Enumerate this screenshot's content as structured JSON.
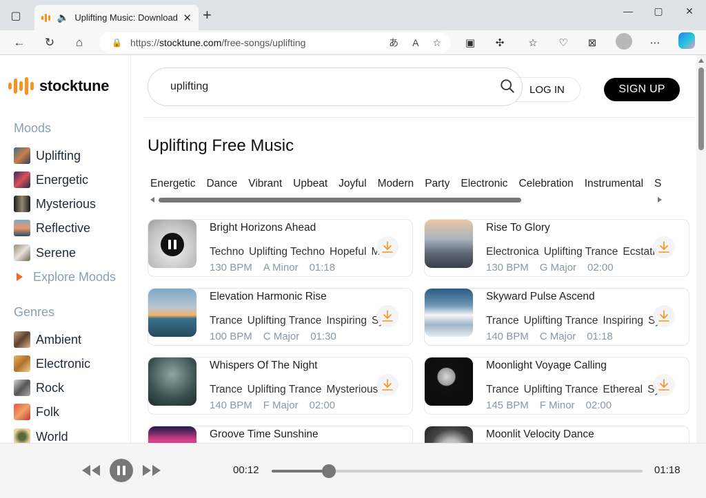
{
  "browser": {
    "tab_title": "Uplifting Music: Download Free",
    "url_prefix": "https://",
    "url_host": "stocktune.com",
    "url_path": "/free-songs/uplifting"
  },
  "site": {
    "logo_text": "stocktune",
    "accent": "#f7931e"
  },
  "sidebar": {
    "moods_heading": "Moods",
    "moods": [
      {
        "label": "Uplifting"
      },
      {
        "label": "Energetic"
      },
      {
        "label": "Mysterious"
      },
      {
        "label": "Reflective"
      },
      {
        "label": "Serene"
      }
    ],
    "explore_label": "Explore Moods",
    "genres_heading": "Genres",
    "genres": [
      {
        "label": "Ambient"
      },
      {
        "label": "Electronic"
      },
      {
        "label": "Rock"
      },
      {
        "label": "Folk"
      },
      {
        "label": "World"
      }
    ]
  },
  "header": {
    "search_value": "uplifting",
    "login_label": "LOG IN",
    "signup_label": "SIGN UP"
  },
  "main": {
    "title": "Uplifting Free Music",
    "chips": [
      "Energetic",
      "Dance",
      "Vibrant",
      "Upbeat",
      "Joyful",
      "Modern",
      "Party",
      "Electronic",
      "Celebration",
      "Instrumental",
      "S"
    ],
    "tracks": [
      {
        "title": "Bright Horizons Ahead",
        "tags": [
          "Techno",
          "Uplifting Techno",
          "Hopeful",
          "M"
        ],
        "bpm": "130 BPM",
        "key": "A Minor",
        "duration": "01:18",
        "playing": true
      },
      {
        "title": "Rise To Glory",
        "tags": [
          "Electronica",
          "Uplifting Trance",
          "Ecstatic"
        ],
        "bpm": "130 BPM",
        "key": "G Major",
        "duration": "02:00",
        "playing": false
      },
      {
        "title": "Elevation Harmonic Rise",
        "tags": [
          "Trance",
          "Uplifting Trance",
          "Inspiring",
          "Sy"
        ],
        "bpm": "100 BPM",
        "key": "C Major",
        "duration": "01:30",
        "playing": false
      },
      {
        "title": "Skyward Pulse Ascend",
        "tags": [
          "Trance",
          "Uplifting Trance",
          "Inspiring",
          "Sy"
        ],
        "bpm": "140 BPM",
        "key": "C Major",
        "duration": "01:18",
        "playing": false
      },
      {
        "title": "Whispers Of The Night",
        "tags": [
          "Trance",
          "Uplifting Trance",
          "Mysterious"
        ],
        "bpm": "140 BPM",
        "key": "F Major",
        "duration": "02:00",
        "playing": false
      },
      {
        "title": "Moonlight Voyage Calling",
        "tags": [
          "Trance",
          "Uplifting Trance",
          "Ethereal",
          "Syi"
        ],
        "bpm": "145 BPM",
        "key": "F Minor",
        "duration": "02:00",
        "playing": false
      },
      {
        "title": "Groove Time Sunshine",
        "tags": [],
        "bpm": "",
        "key": "",
        "duration": "",
        "playing": false
      },
      {
        "title": "Moonlit Velocity Dance",
        "tags": [],
        "bpm": "",
        "key": "",
        "duration": "",
        "playing": false
      }
    ]
  },
  "player": {
    "elapsed": "00:12",
    "total": "01:18",
    "progress": 0.155
  }
}
